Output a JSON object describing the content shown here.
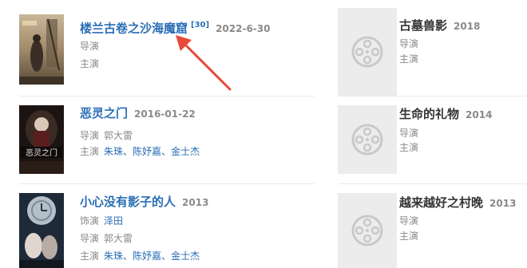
{
  "items": [
    {
      "title": "楼兰古卷之沙海魔窟",
      "badge": "[30]",
      "date": "2022-6-30",
      "director_label": "导演",
      "cast_label": "主演"
    },
    {
      "title": "恶灵之门",
      "date": "2016-01-22",
      "director_label": "导演",
      "director": "郭大雷",
      "cast_label": "主演",
      "cast": [
        "朱珠",
        "陈妤嘉",
        "金士杰"
      ]
    },
    {
      "title": "小心没有影子的人",
      "date": "2013",
      "voice_label": "饰演",
      "voice": "泽田",
      "director_label": "导演",
      "director": "郭大雷",
      "cast_label": "主演",
      "cast": [
        "朱珠",
        "陈妤嘉",
        "金士杰"
      ]
    }
  ],
  "side_items": [
    {
      "title": "古墓兽影",
      "year": "2018",
      "director_label": "导演",
      "cast_label": "主演"
    },
    {
      "title": "生命的礼物",
      "year": "2014",
      "director_label": "导演",
      "cast_label": "主演"
    },
    {
      "title": "越来越好之村晚",
      "year": "2013",
      "director_label": "导演",
      "cast_label": "主演"
    }
  ],
  "poster_text": {
    "p2": "恶灵之门"
  },
  "colors": {
    "link": "#2a6eb5",
    "muted": "#8a8a8a",
    "arrow": "#e8493a",
    "placeholder_bg": "#ececec"
  }
}
